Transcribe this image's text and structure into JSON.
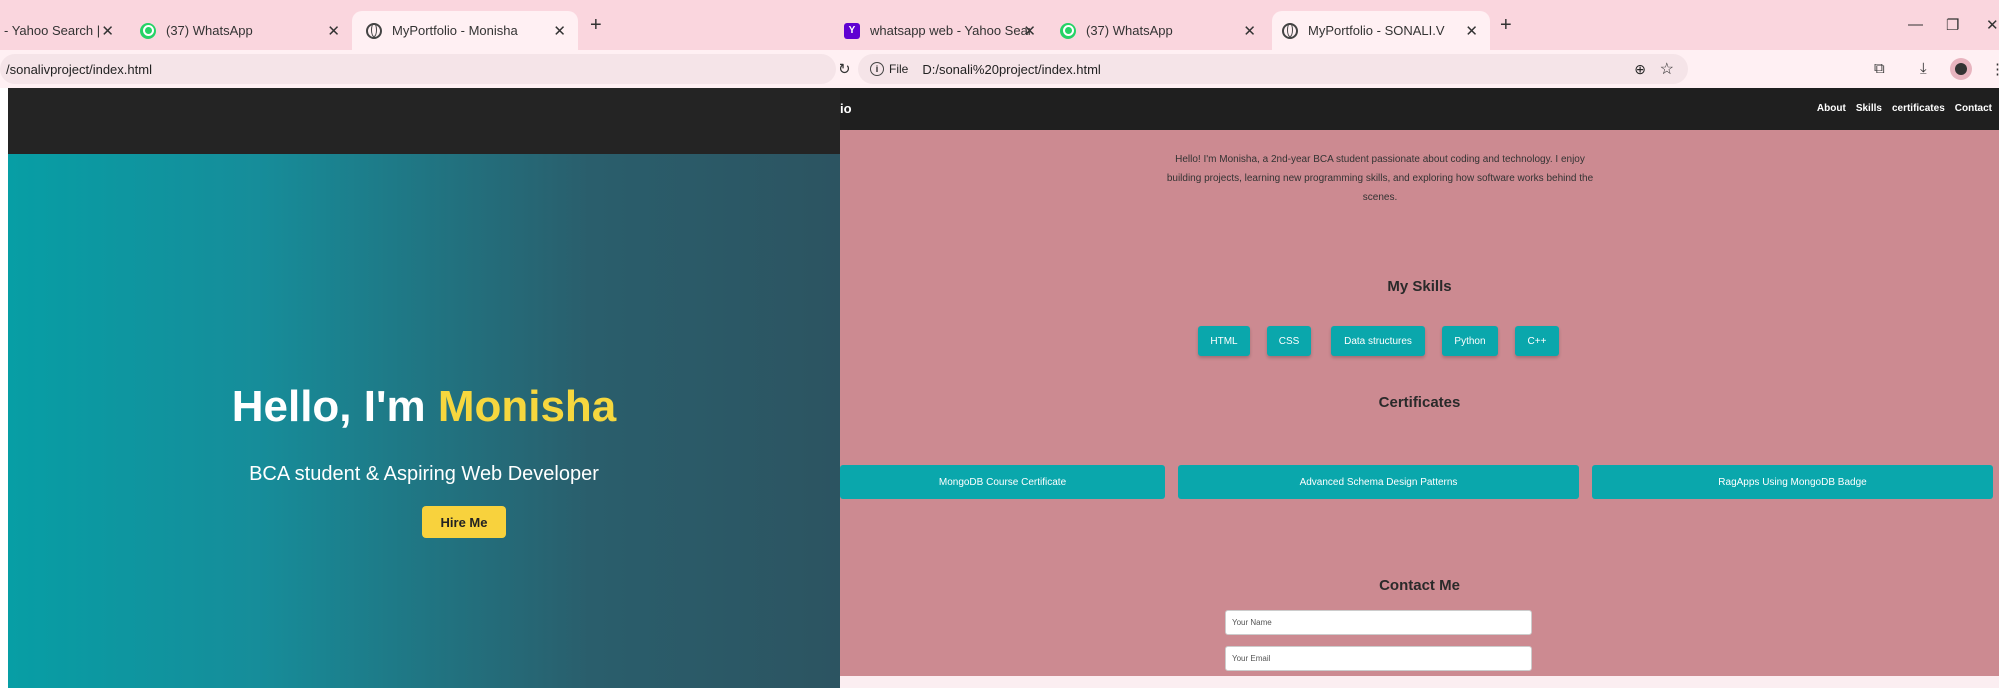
{
  "left": {
    "tabs": [
      {
        "title": "- Yahoo Search |"
      },
      {
        "title": "(37) WhatsApp"
      },
      {
        "title": "MyPortfolio - Monisha"
      }
    ],
    "url": "/sonalivproject/index.html",
    "hero": {
      "greeting": "Hello, I'm",
      "name": "Monisha",
      "subtitle": "BCA student & Aspiring Web Developer",
      "button": "Hire Me"
    }
  },
  "right": {
    "tabs": [
      {
        "title": "whatsapp web - Yahoo Search |"
      },
      {
        "title": "(37) WhatsApp"
      },
      {
        "title": "MyPortfolio - SONALI.V"
      }
    ],
    "site_chip": "File",
    "url": "D:/sonali%20project/index.html",
    "nav": {
      "logo": "io",
      "links": [
        "About",
        "Skills",
        "certificates",
        "Contact"
      ]
    },
    "intro": "Hello! I'm Monisha, a 2nd-year BCA student passionate about coding and technology. I enjoy building projects, learning new programming skills, and exploring how software works behind the scenes.",
    "skills_heading": "My Skills",
    "skills": [
      "HTML",
      "CSS",
      "Data structures",
      "Python",
      "C++"
    ],
    "certificates_heading": "Certificates",
    "certificates": [
      "MongoDB Course Certificate",
      "Advanced Schema Design Patterns",
      "RagApps Using MongoDB Badge"
    ],
    "contact_heading": "Contact Me",
    "contact_fields": [
      {
        "placeholder": "Your Name"
      },
      {
        "placeholder": "Your Email"
      }
    ]
  },
  "colors": {
    "tabstrip": "#fad6de",
    "hero_gradient_start": "#079ea5",
    "hero_gradient_end": "#2c5461",
    "highlight": "#f6d73e",
    "page_bg": "#cc8a91",
    "accent": "#0aa7ac"
  }
}
